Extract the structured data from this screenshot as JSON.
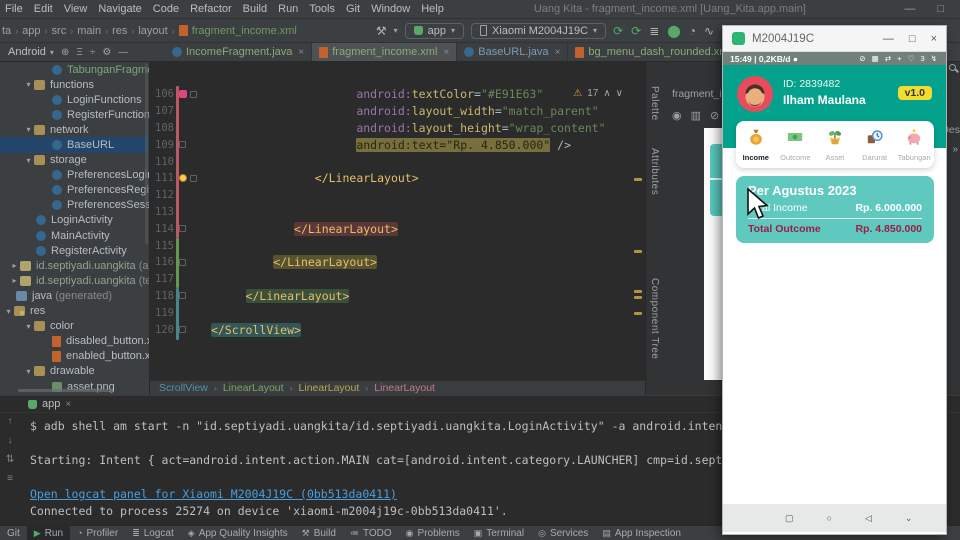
{
  "window": {
    "title": "Uang Kita - fragment_income.xml [Uang_Kita.app.main]",
    "minimize": "—",
    "maximize": "□"
  },
  "menu": {
    "items": [
      "File",
      "Edit",
      "View",
      "Navigate",
      "Code",
      "Refactor",
      "Build",
      "Run",
      "Tools",
      "Git",
      "Window",
      "Help"
    ]
  },
  "navbar": {
    "sep": "›",
    "breadcrumbs": [
      "ta",
      "app",
      "src",
      "main",
      "res",
      "layout"
    ],
    "file": "fragment_income.xml",
    "build_glyph": "⚒",
    "caret": "▾",
    "run_config": "app",
    "device": "Xiaomi M2004J19C",
    "actions": [
      {
        "name": "rerun-icon",
        "glyph": "⟳",
        "color": "#59A869"
      },
      {
        "name": "apply-changes-icon",
        "glyph": "⟳",
        "color": "#59A869"
      },
      {
        "name": "run-list-icon",
        "glyph": "≣",
        "color": "#AFB1B3"
      },
      {
        "name": "debug-icon",
        "glyph": "⬤",
        "color": "#59A869"
      },
      {
        "name": "profiler-icon",
        "glyph": "◔",
        "color": "#AFB1B3"
      },
      {
        "name": "stream-icon",
        "glyph": "∿",
        "color": "#AFB1B3"
      }
    ]
  },
  "project_header": {
    "mode": "Android",
    "caret": "▾",
    "icons": [
      {
        "name": "locate-icon",
        "glyph": "⊕"
      },
      {
        "name": "collapse-all-icon",
        "glyph": "Ξ"
      },
      {
        "name": "scroll-from-source-icon",
        "glyph": "÷"
      },
      {
        "name": "settings-icon",
        "glyph": "⚙"
      },
      {
        "name": "hide-panel-icon",
        "glyph": "—"
      }
    ]
  },
  "editor_tabs": [
    {
      "label": "IncomeFragment.java",
      "icon": "java-class",
      "color": "green",
      "close": "×"
    },
    {
      "label": "fragment_income.xml",
      "icon": "xml-file",
      "color": "green",
      "close": "×",
      "active": true
    },
    {
      "label": "BaseURL.java",
      "icon": "java-class",
      "color": "blue",
      "close": "×"
    },
    {
      "label": "bg_menu_dash_rounded.xml",
      "icon": "xml-file",
      "color": "green",
      "close": "×"
    },
    {
      "label": "bg_overview_",
      "icon": "xml-file",
      "color": "green",
      "close": ""
    }
  ],
  "project_tree": [
    {
      "label": "TabunganFragment",
      "icon": "class",
      "indent": 52,
      "color": "green"
    },
    {
      "label": "functions",
      "icon": "folder",
      "arrow": "▾",
      "indent": 36
    },
    {
      "label": "LoginFunctions",
      "icon": "class",
      "indent": 52
    },
    {
      "label": "RegisterFunctions",
      "icon": "class",
      "indent": 52
    },
    {
      "label": "network",
      "icon": "folder",
      "arrow": "▾",
      "indent": 36
    },
    {
      "label": "BaseURL",
      "icon": "class",
      "indent": 52,
      "selected": true
    },
    {
      "label": "storage",
      "icon": "folder",
      "arrow": "▾",
      "indent": 36
    },
    {
      "label": "PreferencesLogin",
      "icon": "class",
      "indent": 52
    },
    {
      "label": "PreferencesRegister",
      "icon": "class",
      "indent": 52
    },
    {
      "label": "PreferencesSessionLo",
      "icon": "class",
      "indent": 52
    },
    {
      "label": "LoginActivity",
      "icon": "class",
      "indent": 36
    },
    {
      "label": "MainActivity",
      "icon": "class",
      "indent": 36
    },
    {
      "label": "RegisterActivity",
      "icon": "class",
      "indent": 36
    },
    {
      "label": "id.septiyadi.uangkita",
      "suffix": "(andro",
      "icon": "package",
      "arrow": "▸",
      "indent": 22,
      "color": "sage"
    },
    {
      "label": "id.septiyadi.uangkita",
      "suffix": "(test)",
      "icon": "package",
      "arrow": "▸",
      "indent": 22,
      "color": "sage"
    },
    {
      "label": "java",
      "suffix": "(generated)",
      "icon": "folder-gen",
      "indent": 16
    },
    {
      "label": "res",
      "icon": "folder-res",
      "arrow": "▾",
      "indent": 16
    },
    {
      "label": "color",
      "icon": "folder",
      "arrow": "▾",
      "indent": 36
    },
    {
      "label": "disabled_button.xml",
      "icon": "xml-file",
      "indent": 52
    },
    {
      "label": "enabled_button.xml",
      "icon": "xml-file",
      "indent": 52
    },
    {
      "label": "drawable",
      "icon": "folder",
      "arrow": "▾",
      "indent": 36
    },
    {
      "label": "asset.png",
      "icon": "image-file",
      "indent": 52
    }
  ],
  "editor": {
    "inspection": {
      "warn_glyph": "⚠",
      "count": "17",
      "up": "∧",
      "down": "∨"
    },
    "stripe_marks": [
      116,
      188,
      228,
      234,
      250
    ],
    "lines": [
      {
        "num": "106",
        "indent": 22,
        "gutter": [
          "bp",
          "fold"
        ],
        "segs": [
          [
            "ns",
            "android:"
          ],
          [
            "an",
            "textColor"
          ],
          [
            "eq",
            "="
          ],
          [
            "str",
            "\"#E91E63\""
          ]
        ]
      },
      {
        "num": "107",
        "indent": 22,
        "gutter": [],
        "segs": [
          [
            "ns",
            "android:"
          ],
          [
            "an",
            "layout_width"
          ],
          [
            "eq",
            "="
          ],
          [
            "str",
            "\"match_parent\""
          ]
        ]
      },
      {
        "num": "108",
        "indent": 22,
        "gutter": [],
        "segs": [
          [
            "ns",
            "android:"
          ],
          [
            "an",
            "layout_height"
          ],
          [
            "eq",
            "="
          ],
          [
            "str",
            "\"wrap_content\""
          ]
        ]
      },
      {
        "num": "109",
        "indent": 22,
        "gutter": [
          "fold"
        ],
        "hl": "khaki",
        "segs": [
          [
            "ns",
            "android:"
          ],
          [
            "an",
            "text"
          ],
          [
            "eq",
            "="
          ],
          [
            "str",
            "\"Rp. 4.850.000\""
          ]
        ],
        "tail": " />"
      },
      {
        "num": "110",
        "indent": 0,
        "gutter": [],
        "segs": []
      },
      {
        "num": "111",
        "indent": 16,
        "gutter": [
          "bulb",
          "fold"
        ],
        "segs": [
          [
            "tag",
            "</LinearLayout>"
          ]
        ]
      },
      {
        "num": "112",
        "indent": 0,
        "gutter": [],
        "segs": []
      },
      {
        "num": "113",
        "indent": 0,
        "gutter": [],
        "segs": []
      },
      {
        "num": "114",
        "indent": 13,
        "gutter": [
          "fold"
        ],
        "hl": "red",
        "segs": [
          [
            "tag",
            "</LinearLayout>"
          ]
        ]
      },
      {
        "num": "115",
        "indent": 0,
        "gutter": [],
        "segs": []
      },
      {
        "num": "116",
        "indent": 10,
        "gutter": [
          "fold"
        ],
        "hl": "olive",
        "segs": [
          [
            "tag",
            "</LinearLayout>"
          ]
        ]
      },
      {
        "num": "117",
        "indent": 0,
        "gutter": [],
        "segs": []
      },
      {
        "num": "118",
        "indent": 6,
        "gutter": [
          "fold"
        ],
        "hl": "green",
        "segs": [
          [
            "tag",
            "</LinearLayout>"
          ]
        ]
      },
      {
        "num": "119",
        "indent": 0,
        "gutter": [],
        "segs": []
      },
      {
        "num": "120",
        "indent": 1,
        "gutter": [
          "fold"
        ],
        "hl": "teal",
        "segs": [
          [
            "tag",
            "</ScrollView>"
          ]
        ]
      }
    ]
  },
  "xml_breadcrumbs": [
    {
      "label": "ScrollView",
      "color": "#4E93A8"
    },
    {
      "label": "LinearLayout",
      "color": "#79A663"
    },
    {
      "label": "LinearLayout",
      "color": "#B8A94E"
    },
    {
      "label": "LinearLayout",
      "color": "#C4798B"
    }
  ],
  "design": {
    "tab": "fragment_inco",
    "tools": [
      {
        "name": "eye-icon",
        "glyph": "◉"
      },
      {
        "name": "columns-icon",
        "glyph": "▥"
      },
      {
        "name": "magnet-off-icon",
        "glyph": "⊘"
      }
    ],
    "side_labels": [
      "Palette",
      "Attributes",
      "Component Tree"
    ],
    "design_tab": "Des",
    "chevrons": "»"
  },
  "run_panel": {
    "tab": "app",
    "close": "×",
    "gutter_icons": [
      {
        "name": "scroll-up-icon",
        "glyph": "↑"
      },
      {
        "name": "scroll-down-icon",
        "glyph": "↓"
      },
      {
        "name": "soft-wrap-icon",
        "glyph": "⇅"
      },
      {
        "name": "settings-lines-icon",
        "glyph": "≡"
      }
    ],
    "lines": [
      {
        "type": "cmd",
        "text": "$ adb shell am start -n \"id.septiyadi.uangkita/id.septiyadi.uangkita.LoginActivity\" -a android.intent.action.MAIN"
      },
      {
        "type": "blank",
        "text": ""
      },
      {
        "type": "out",
        "text": "Starting: Intent { act=android.intent.action.MAIN cat=[android.intent.category.LAUNCHER] cmp=id.septiyadi.uangkita"
      },
      {
        "type": "blank",
        "text": ""
      },
      {
        "type": "link",
        "text": "Open logcat panel for Xiaomi M2004J19C (0bb513da0411)"
      },
      {
        "type": "out",
        "text": "Connected to process 25274 on device 'xiaomi-m2004j19c-0bb513da0411'."
      }
    ]
  },
  "status_bar": {
    "items": [
      {
        "label": "Git",
        "glyph": ""
      },
      {
        "label": "Run",
        "glyph": "▶",
        "green": true,
        "active": true
      },
      {
        "label": "Profiler",
        "glyph": "◔"
      },
      {
        "label": "Logcat",
        "glyph": "≣"
      },
      {
        "label": "App Quality Insights",
        "glyph": "◈"
      },
      {
        "label": "Build",
        "glyph": "⚒"
      },
      {
        "label": "TODO",
        "glyph": "≔"
      },
      {
        "label": "Problems",
        "glyph": "◉"
      },
      {
        "label": "Terminal",
        "glyph": "▣"
      },
      {
        "label": "Services",
        "glyph": "◎"
      },
      {
        "label": "App Inspection",
        "glyph": "▤"
      }
    ]
  },
  "phone": {
    "window_title": "M2004J19C",
    "controls": {
      "min": "—",
      "max": "□",
      "close": "×"
    },
    "status_left": "15:49 | 0,2KB/d ●",
    "status_icons": "⊘ ▦ ⇄ + ♡ 3 ↯",
    "header": {
      "user_id": "ID: 2839482",
      "user_name": "Ilham Maulana",
      "version_badge": "v1.0"
    },
    "menu": [
      {
        "label": "Income",
        "icon": "money-bag",
        "active": true
      },
      {
        "label": "Outcome",
        "icon": "banknote"
      },
      {
        "label": "Asset",
        "icon": "plant"
      },
      {
        "label": "Darurat",
        "icon": "clock"
      },
      {
        "label": "Tabungan",
        "icon": "piggy-bank"
      }
    ],
    "summary": {
      "period": "Per Agustus 2023",
      "rows": [
        {
          "label": "Total Income",
          "value": "Rp. 6.000.000",
          "tone": "light"
        },
        {
          "label": "Total Outcome",
          "value": "Rp. 4.850.000",
          "tone": "danger"
        }
      ]
    },
    "nav": [
      {
        "name": "recents-icon",
        "glyph": "▢"
      },
      {
        "name": "home-icon",
        "glyph": "○"
      },
      {
        "name": "back-icon",
        "glyph": "◁"
      },
      {
        "name": "collapse-icon",
        "glyph": "⌄"
      }
    ],
    "colors": {
      "header_teal": "#04A28C",
      "summary_card": "#5FC9C0",
      "badge_yellow": "#F2DC30",
      "outcome_red": "#9E1C47"
    }
  }
}
